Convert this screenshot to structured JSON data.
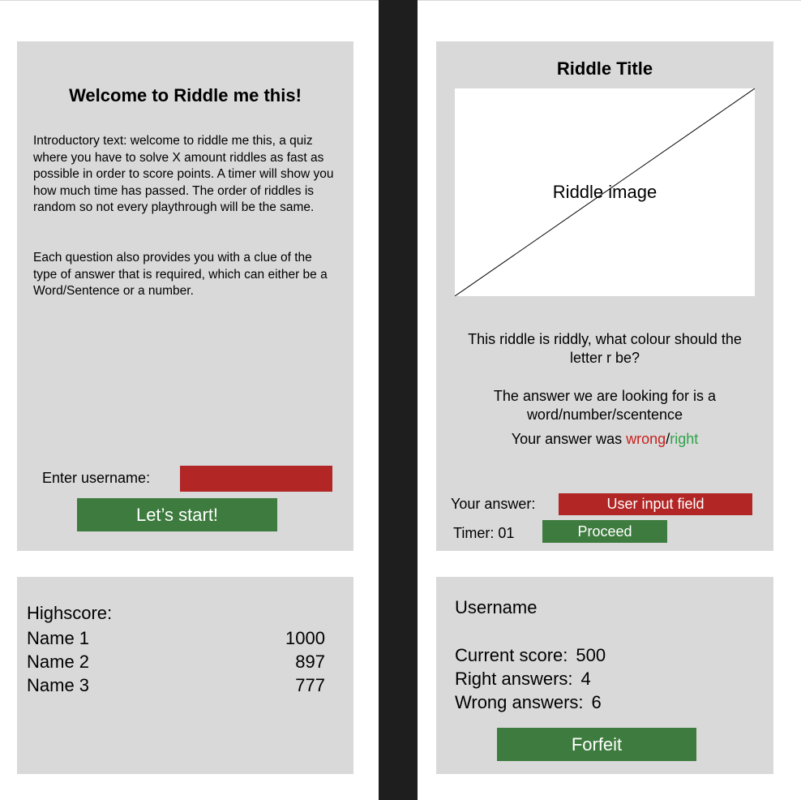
{
  "welcome": {
    "title": "Welcome to Riddle me this!",
    "intro": "Introductory text: welcome to riddle me this, a quiz where you have to solve X amount riddles as fast as possible in order to score points. A timer will show you how much time has passed. The order of riddles is random so not every playthrough will be the same.",
    "clue_text": "Each question also provides you with a clue of the type of answer that is required, which can either be a Word/Sentence or a number.",
    "username_label": "Enter username:",
    "username_value": "",
    "start_label": "Let’s start!"
  },
  "highscore": {
    "title": "Highscore:",
    "entries": [
      {
        "name": "Name 1",
        "score": "1000"
      },
      {
        "name": "Name 2",
        "score": "897"
      },
      {
        "name": "Name 3",
        "score": "777"
      }
    ]
  },
  "riddle": {
    "title": "Riddle Title",
    "image_label": "Riddle image",
    "question": "This riddle is riddly, what colour should the letter r be?",
    "answer_hint": "The answer we are looking for is a word/number/scentence",
    "result_prefix": "Your answer was ",
    "result_wrong": "wrong",
    "result_sep": "/",
    "result_right": "right",
    "answer_label": "Your answer:",
    "answer_placeholder": "User input field",
    "timer_label": "Timer: 01",
    "proceed_label": "Proceed"
  },
  "score": {
    "username": "Username",
    "current_label": "Current score:",
    "current_value": "500",
    "right_label": "Right answers:",
    "right_value": "4",
    "wrong_label": "Wrong answers:",
    "wrong_value": "6",
    "forfeit_label": "Forfeit"
  },
  "colors": {
    "panel": "#d9d9d9",
    "divider": "#1e1e1e",
    "input_red": "#b22626",
    "button_green": "#3e7b3e",
    "wrong_red": "#c8201c",
    "right_green": "#2ea24a"
  }
}
